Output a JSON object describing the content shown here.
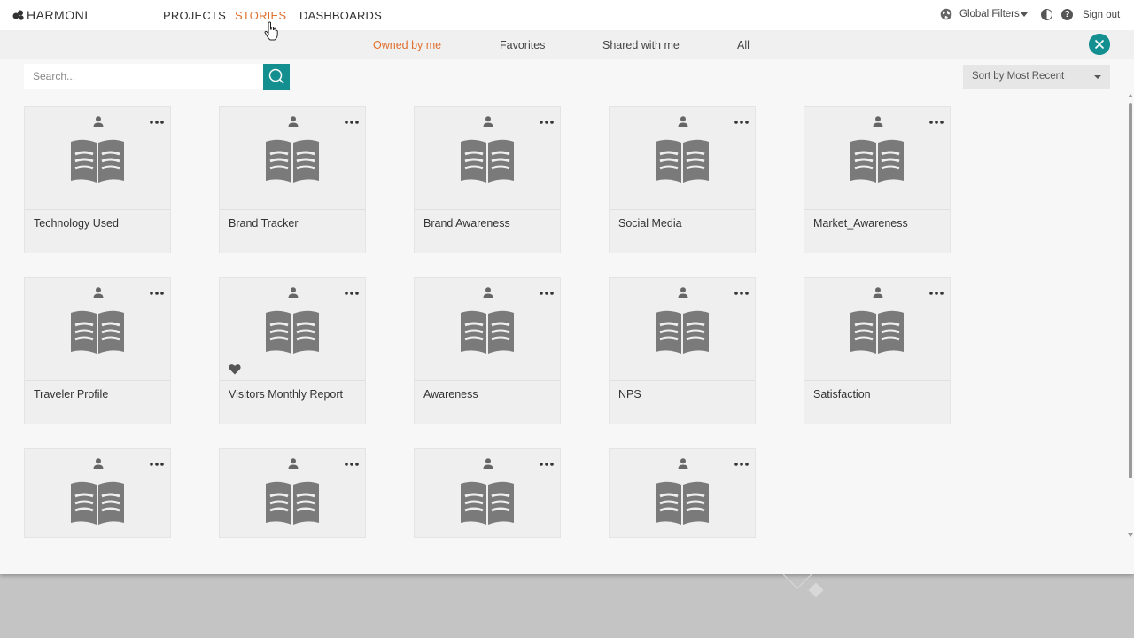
{
  "app": {
    "logo_text": "HARMONI"
  },
  "nav": {
    "projects": "PROJECTS",
    "stories": "STORIES",
    "dashboards": "DASHBOARDS",
    "active": "STORIES",
    "active_color": "#e0702f"
  },
  "header_right": {
    "global_filters": "Global Filters",
    "sign_out": "Sign out"
  },
  "subtabs": {
    "owned": "Owned by me",
    "favorites": "Favorites",
    "shared": "Shared with me",
    "all": "All",
    "active": "Owned by me"
  },
  "search": {
    "placeholder": "Search..."
  },
  "sort": {
    "selected": "Sort by Most Recent"
  },
  "accent_color": "#138f8f",
  "cards": [
    {
      "title": "Technology Used",
      "favorite": false
    },
    {
      "title": "Brand Tracker",
      "favorite": false
    },
    {
      "title": "Brand Awareness",
      "favorite": false
    },
    {
      "title": "Social Media",
      "favorite": false
    },
    {
      "title": "Market_Awareness",
      "favorite": false
    },
    {
      "title": "Traveler Profile",
      "favorite": false
    },
    {
      "title": "Visitors Monthly Report",
      "favorite": true
    },
    {
      "title": "Awareness",
      "favorite": false
    },
    {
      "title": "NPS",
      "favorite": false
    },
    {
      "title": "Satisfaction",
      "favorite": false
    },
    {
      "title": "",
      "favorite": false
    },
    {
      "title": "",
      "favorite": false
    },
    {
      "title": "",
      "favorite": false
    },
    {
      "title": "",
      "favorite": false
    }
  ]
}
